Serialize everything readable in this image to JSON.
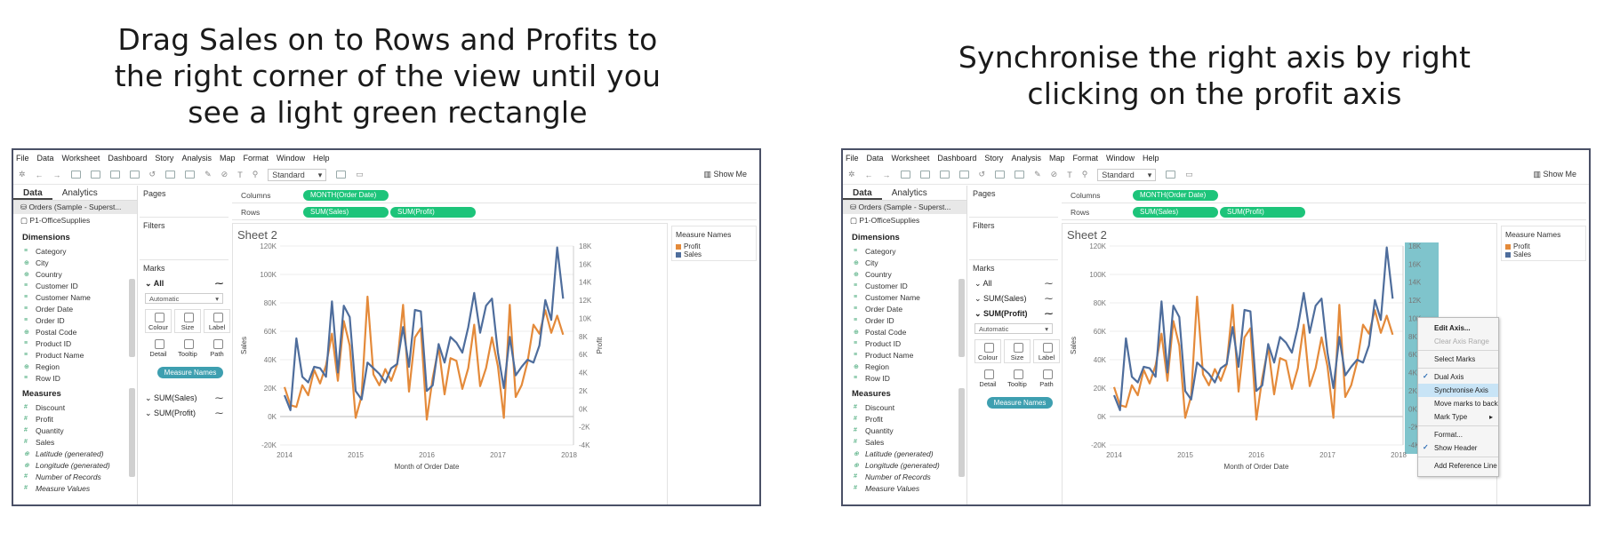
{
  "captions": {
    "left": [
      "Drag Sales on to Rows and Profits to",
      "the right corner of the view until you",
      "see a light green rectangle"
    ],
    "right": [
      "Synchronise the right axis by right",
      "clicking on the profit axis"
    ]
  },
  "menu": [
    "File",
    "Data",
    "Worksheet",
    "Dashboard",
    "Story",
    "Analysis",
    "Map",
    "Format",
    "Window",
    "Help"
  ],
  "toolbar": {
    "standard": "Standard",
    "show_me": "Show Me"
  },
  "data_pane": {
    "tabs": [
      "Data",
      "Analytics"
    ],
    "sources": [
      "Orders (Sample - Superst...",
      "P1-OfficeSupplies"
    ],
    "dimensions_header": "Dimensions",
    "dimensions": [
      "Category",
      "City",
      "Country",
      "Customer ID",
      "Customer Name",
      "Order Date",
      "Order ID",
      "Postal Code",
      "Product ID",
      "Product Name",
      "Region",
      "Row ID"
    ],
    "measures_header": "Measures",
    "measures": [
      "Discount",
      "Profit",
      "Quantity",
      "Sales",
      "Latitude (generated)",
      "Longitude (generated)",
      "Number of Records",
      "Measure Values"
    ]
  },
  "cards": {
    "pages": "Pages",
    "filters": "Filters",
    "marks": "Marks",
    "all": "All",
    "sum_sales": "SUM(Sales)",
    "sum_profit": "SUM(Profit)",
    "automatic": "Automatic",
    "buttons": [
      "Colour",
      "Size",
      "Label",
      "Detail",
      "Tooltip",
      "Path"
    ],
    "measure_names_pill": "Measure Names"
  },
  "shelves": {
    "columns_label": "Columns",
    "rows_label": "Rows",
    "columns_pill": "MONTH(Order Date)",
    "rows_pills": [
      "SUM(Sales)",
      "SUM(Profit)"
    ]
  },
  "sheet": {
    "title": "Sheet 2"
  },
  "legend": {
    "title": "Measure Names",
    "items": [
      "Profit",
      "Sales"
    ]
  },
  "context_menu": {
    "items": [
      "Edit Axis...",
      "Clear Axis Range",
      "Select Marks",
      "Dual Axis",
      "Synchronise Axis",
      "Move marks to back",
      "Mark Type",
      "Format...",
      "Show Header",
      "Add Reference Line"
    ],
    "checked": [
      "Dual Axis",
      "Show Header"
    ],
    "highlighted": "Synchronise Axis"
  },
  "colors": {
    "sales": "#4e6d9c",
    "profit": "#e48a3a",
    "pill_green": "#1dc47a",
    "pill_teal": "#3e9fb0",
    "axis_highlight": "#7fc4cc"
  },
  "chart_data": {
    "type": "line",
    "x": [
      "2014-01",
      "2014-02",
      "2014-03",
      "2014-04",
      "2014-05",
      "2014-06",
      "2014-07",
      "2014-08",
      "2014-09",
      "2014-10",
      "2014-11",
      "2014-12",
      "2015-01",
      "2015-02",
      "2015-03",
      "2015-04",
      "2015-05",
      "2015-06",
      "2015-07",
      "2015-08",
      "2015-09",
      "2015-10",
      "2015-11",
      "2015-12",
      "2016-01",
      "2016-02",
      "2016-03",
      "2016-04",
      "2016-05",
      "2016-06",
      "2016-07",
      "2016-08",
      "2016-09",
      "2016-10",
      "2016-11",
      "2016-12",
      "2017-01",
      "2017-02",
      "2017-03",
      "2017-04",
      "2017-05",
      "2017-06",
      "2017-07",
      "2017-08",
      "2017-09",
      "2017-10",
      "2017-11",
      "2017-12"
    ],
    "x_ticks": [
      "2014",
      "2015",
      "2016",
      "2017",
      "2018"
    ],
    "xlabel": "Month of Order Date",
    "ylabel": "Sales",
    "ylabel_right": "Profit",
    "ylim": [
      -20000,
      120000
    ],
    "yticks": [
      "-20K",
      "0K",
      "20K",
      "40K",
      "60K",
      "80K",
      "100K",
      "120K"
    ],
    "ylim_right": [
      -4000,
      18000
    ],
    "yticks_right": [
      "-4K",
      "-2K",
      "0K",
      "2K",
      "4K",
      "6K",
      "8K",
      "10K",
      "12K",
      "14K",
      "16K",
      "18K"
    ],
    "series": [
      {
        "name": "Sales",
        "axis": "left",
        "values": [
          15000,
          4500,
          55000,
          28000,
          24000,
          35000,
          34000,
          28000,
          81000,
          31000,
          78000,
          70000,
          18000,
          12000,
          38000,
          34000,
          30000,
          24000,
          34000,
          37000,
          63000,
          35000,
          75000,
          74000,
          18000,
          22000,
          51000,
          38000,
          56000,
          52000,
          45000,
          63000,
          87000,
          59000,
          78000,
          83000,
          45000,
          20000,
          56000,
          29000,
          35000,
          40000,
          38000,
          50000,
          82000,
          68000,
          119000,
          83000
        ]
      },
      {
        "name": "Profit",
        "axis": "right",
        "values": [
          2400,
          400,
          200,
          2600,
          1500,
          4300,
          2800,
          4800,
          8300,
          3100,
          9700,
          7000,
          -1000,
          1400,
          12400,
          3800,
          2600,
          4400,
          3100,
          4900,
          11500,
          1900,
          7900,
          8900,
          -1200,
          3400,
          6800,
          1600,
          5600,
          5300,
          2200,
          4500,
          9300,
          2500,
          4500,
          7900,
          4700,
          -1000,
          11500,
          1300,
          2600,
          5200,
          9300,
          8300,
          10900,
          8400,
          10300,
          8200
        ]
      }
    ]
  }
}
